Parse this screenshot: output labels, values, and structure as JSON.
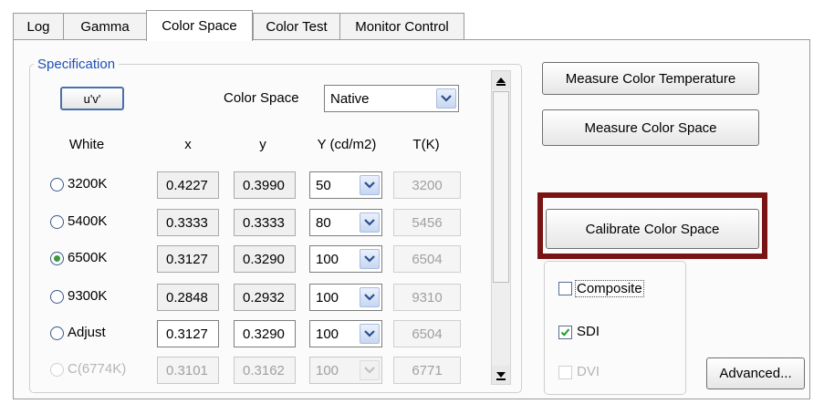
{
  "tabs": [
    {
      "label": "Log",
      "active": false
    },
    {
      "label": "Gamma",
      "active": false
    },
    {
      "label": "Color Space",
      "active": true
    },
    {
      "label": "Color Test",
      "active": false
    },
    {
      "label": "Monitor Control",
      "active": false
    }
  ],
  "specification": {
    "legend": "Specification",
    "uv_button": "u'v'",
    "color_space_label": "Color Space",
    "color_space_value": "Native",
    "headers": {
      "white": "White",
      "x": "x",
      "y": "y",
      "Y": "Y (cd/m2)",
      "T": "T(K)"
    },
    "rows": [
      {
        "label": "3200K",
        "x": "0.4227",
        "y": "0.3990",
        "Y": "50",
        "T": "3200",
        "selected": false,
        "disabled": false
      },
      {
        "label": "5400K",
        "x": "0.3333",
        "y": "0.3333",
        "Y": "80",
        "T": "5456",
        "selected": false,
        "disabled": false
      },
      {
        "label": "6500K",
        "x": "0.3127",
        "y": "0.3290",
        "Y": "100",
        "T": "6504",
        "selected": true,
        "disabled": false
      },
      {
        "label": "9300K",
        "x": "0.2848",
        "y": "0.2932",
        "Y": "100",
        "T": "9310",
        "selected": false,
        "disabled": false
      },
      {
        "label": "Adjust",
        "x": "0.3127",
        "y": "0.3290",
        "Y": "100",
        "T": "6504",
        "selected": false,
        "disabled": false
      },
      {
        "label": "C(6774K)",
        "x": "0.3101",
        "y": "0.3162",
        "Y": "100",
        "T": "6771",
        "selected": false,
        "disabled": true
      }
    ]
  },
  "buttons": {
    "measure_temp": "Measure Color Temperature",
    "measure_space": "Measure Color Space",
    "calibrate": "Calibrate Color Space",
    "advanced": "Advanced..."
  },
  "outputs": [
    {
      "label": "Composite",
      "checked": false,
      "disabled": false
    },
    {
      "label": "SDI",
      "checked": true,
      "disabled": false
    },
    {
      "label": "DVI",
      "checked": false,
      "disabled": true
    }
  ],
  "colors": {
    "highlight": "#7a1414",
    "legend": "#1f4fb5",
    "radio_dot": "#3c9a38"
  },
  "icons": {
    "dropdown": "chevron-down-icon",
    "scroll_up": "scroll-up-arrow-icon",
    "scroll_down": "scroll-down-arrow-icon",
    "checkmark": "checkmark-icon"
  }
}
